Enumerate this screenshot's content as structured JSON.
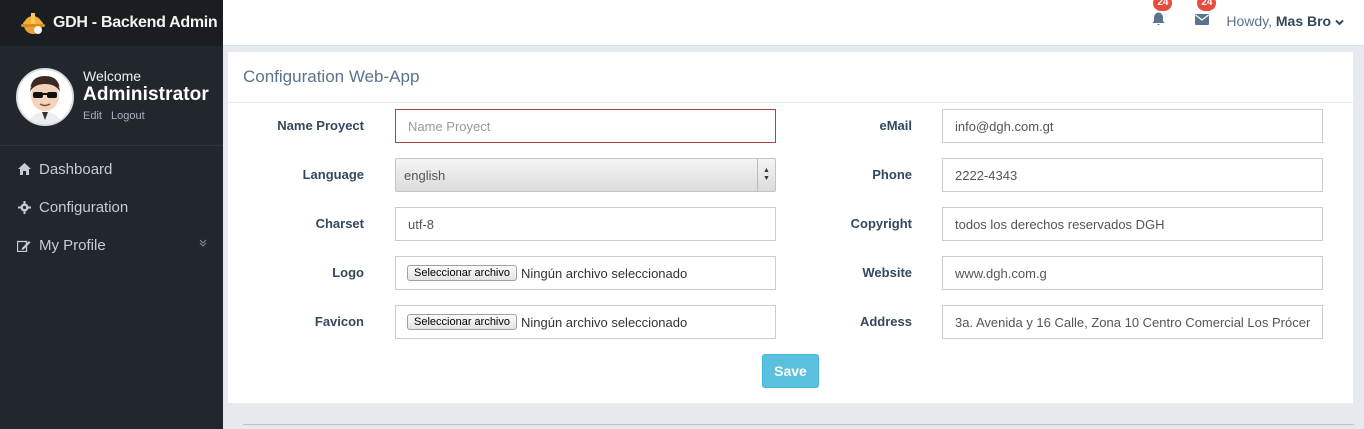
{
  "brand": {
    "title": "GDH - Backend Admin"
  },
  "profile": {
    "welcome": "Welcome",
    "name": "Administrator",
    "edit": "Edit",
    "logout": "Logout"
  },
  "nav": {
    "items": [
      {
        "label": "Dashboard",
        "icon": "home-icon"
      },
      {
        "label": "Configuration",
        "icon": "gear-icon"
      },
      {
        "label": "My Profile",
        "icon": "edit-icon"
      }
    ]
  },
  "topbar": {
    "bell_count": "24",
    "mail_count": "24",
    "howdy": "Howdy,",
    "user": "Mas Bro"
  },
  "panel": {
    "title": "Configuration Web-App"
  },
  "form": {
    "name_label": "Name Proyect",
    "name_placeholder": "Name Proyect",
    "language_label": "Language",
    "language_value": "english",
    "charset_label": "Charset",
    "charset_value": "utf-8",
    "logo_label": "Logo",
    "favicon_label": "Favicon",
    "file_button": "Seleccionar archivo",
    "file_none": "Ningún archivo seleccionado",
    "email_label": "eMail",
    "email_value": "info@dgh.com.gt",
    "phone_label": "Phone",
    "phone_value": "2222-4343",
    "copyright_label": "Copyright",
    "copyright_value": "todos los derechos reservados DGH",
    "website_label": "Website",
    "website_value": "www.dgh.com.g",
    "address_label": "Address",
    "address_value": "3a. Avenida y 16 Calle, Zona 10  Centro Comercial Los Prócer",
    "save_label": "Save"
  },
  "colors": {
    "sidebar": "#22272d",
    "brand_bar": "#1a1d21",
    "badge": "#e74c3c",
    "save_button": "#5bc0de",
    "invalid_border": "#a94442"
  }
}
